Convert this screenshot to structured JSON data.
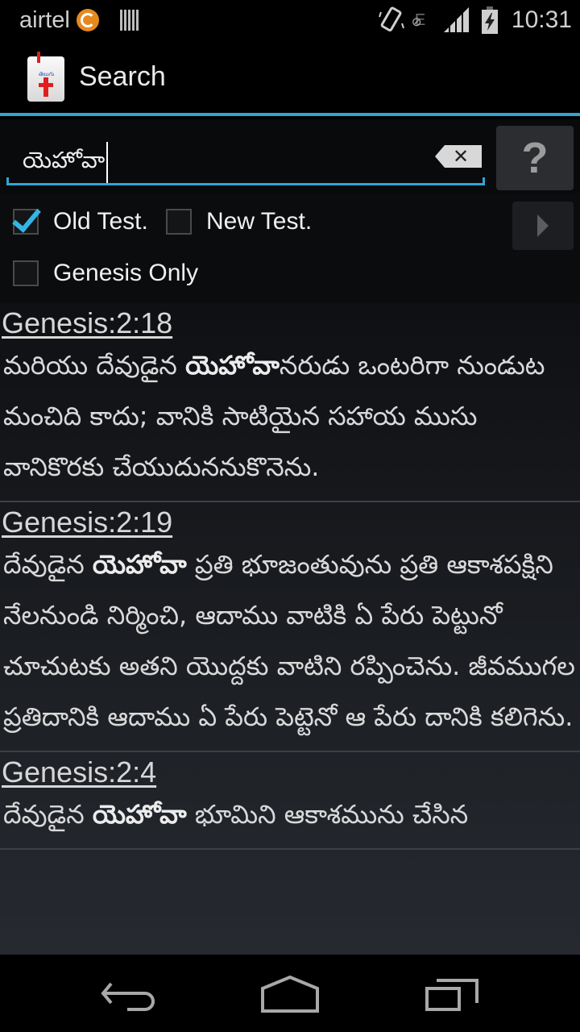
{
  "status_bar": {
    "carrier": "airtel",
    "time": "10:31",
    "network_type": "E",
    "icons": [
      "airtel-logo-icon",
      "sim-card-icon",
      "vibrate-icon",
      "no-data-icon",
      "signal-icon",
      "battery-charging-icon"
    ]
  },
  "action_bar": {
    "title": "Search",
    "app_icon": "telugu-bible-icon",
    "app_icon_text": "తెలుగు"
  },
  "search": {
    "query": "యెహోవా",
    "clear_icon": "backspace-clear-icon",
    "help_label": "?"
  },
  "filters": {
    "old_testament": {
      "label": "Old Test.",
      "checked": true
    },
    "new_testament": {
      "label": "New Test.",
      "checked": false
    },
    "genesis_only": {
      "label": "Genesis Only",
      "checked": false
    },
    "next_icon": "next-arrow-icon"
  },
  "colors": {
    "accent": "#33a3d6",
    "checkbox_accent": "#33b5e5"
  },
  "results": [
    {
      "reference": "Genesis:2:18",
      "before": "మరియు దేవుడైన ",
      "match": "యెహోవా",
      "after": "నరుడు ఒంటరిగా నుండుట మంచిది కాదు; వానికి సాటియైన సహాయ ముసు వానికొరకు చేయుదుననుకొనెను."
    },
    {
      "reference": "Genesis:2:19",
      "before": "దేవుడైన ",
      "match": "యెహోవా",
      "after": " ప్రతి భూజంతువును ప్రతి ఆకాశపక్షిని నేలనుండి నిర్మించి, ఆదాము వాటికి ఏ పేరు పెట్టునో చూచుటకు అతని యొద్దకు వాటిని రప్పించెను. జీవముగల ప్రతిదానికి ఆదాము ఏ పేరు పెట్టెనో ఆ పేరు దానికి కలిగెను."
    },
    {
      "reference": "Genesis:2:4",
      "before": "దేవుడైన ",
      "match": "యెహోవా",
      "after": " భూమిని ఆకాశమును చేసిన"
    }
  ],
  "nav_bar": {
    "back": "back-icon",
    "home": "home-icon",
    "recents": "recent-apps-icon"
  }
}
